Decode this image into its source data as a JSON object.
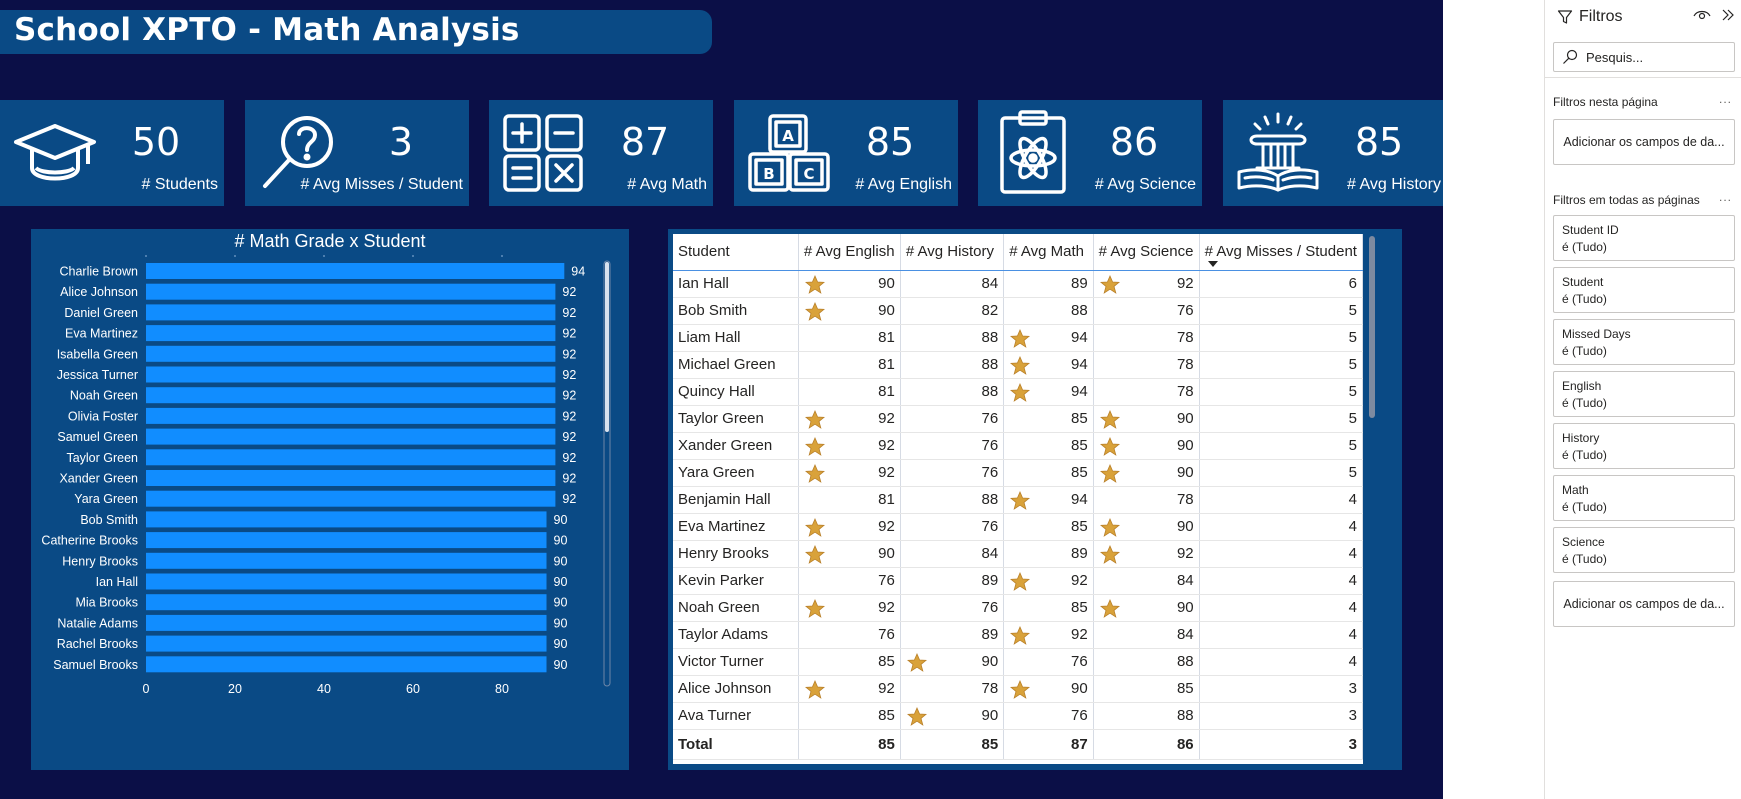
{
  "report": {
    "title": "School XPTO - Math Analysis",
    "kpis": [
      {
        "value": "50",
        "label": "# Students",
        "icon": "graduation-cap-icon"
      },
      {
        "value": "3",
        "label": "# Avg Misses / Student",
        "icon": "magnifier-question-icon"
      },
      {
        "value": "87",
        "label": "# Avg Math",
        "icon": "calculator-symbols-icon"
      },
      {
        "value": "85",
        "label": "# Avg English",
        "icon": "abc-blocks-icon"
      },
      {
        "value": "86",
        "label": "# Avg Science",
        "icon": "atom-clipboard-icon"
      },
      {
        "value": "85",
        "label": "# Avg History",
        "icon": "greek-column-book-icon"
      }
    ]
  },
  "chart_data": {
    "type": "bar",
    "orientation": "horizontal",
    "title": "# Math Grade x Student",
    "categories": [
      "Charlie Brown",
      "Alice Johnson",
      "Daniel Green",
      "Eva Martinez",
      "Isabella Green",
      "Jessica Turner",
      "Noah Green",
      "Olivia Foster",
      "Samuel Green",
      "Taylor Green",
      "Xander Green",
      "Yara Green",
      "Bob Smith",
      "Catherine Brooks",
      "Henry Brooks",
      "Ian Hall",
      "Mia Brooks",
      "Natalie Adams",
      "Rachel Brooks",
      "Samuel Brooks"
    ],
    "values": [
      94,
      92,
      92,
      92,
      92,
      92,
      92,
      92,
      92,
      92,
      92,
      92,
      90,
      90,
      90,
      90,
      90,
      90,
      90,
      90
    ],
    "xticks": [
      0,
      20,
      40,
      60,
      80
    ],
    "xlim": [
      0,
      100
    ],
    "bar_color": "#118dff",
    "grid": false
  },
  "table": {
    "columns": [
      "Student",
      "# Avg English",
      "# Avg History",
      "# Avg Math",
      "# Avg Science",
      "# Avg Misses / Student"
    ],
    "rows": [
      {
        "cells": [
          "Ian Hall",
          "90",
          "84",
          "89",
          "92",
          "6"
        ],
        "stars": [
          1,
          0,
          0,
          1
        ]
      },
      {
        "cells": [
          "Bob Smith",
          "90",
          "82",
          "88",
          "76",
          "5"
        ],
        "stars": [
          1,
          0,
          0,
          0
        ]
      },
      {
        "cells": [
          "Liam Hall",
          "81",
          "88",
          "94",
          "78",
          "5"
        ],
        "stars": [
          0,
          0,
          1,
          0
        ]
      },
      {
        "cells": [
          "Michael Green",
          "81",
          "88",
          "94",
          "78",
          "5"
        ],
        "stars": [
          0,
          0,
          1,
          0
        ]
      },
      {
        "cells": [
          "Quincy Hall",
          "81",
          "88",
          "94",
          "78",
          "5"
        ],
        "stars": [
          0,
          0,
          1,
          0
        ]
      },
      {
        "cells": [
          "Taylor Green",
          "92",
          "76",
          "85",
          "90",
          "5"
        ],
        "stars": [
          1,
          0,
          0,
          1
        ]
      },
      {
        "cells": [
          "Xander Green",
          "92",
          "76",
          "85",
          "90",
          "5"
        ],
        "stars": [
          1,
          0,
          0,
          1
        ]
      },
      {
        "cells": [
          "Yara Green",
          "92",
          "76",
          "85",
          "90",
          "5"
        ],
        "stars": [
          1,
          0,
          0,
          1
        ]
      },
      {
        "cells": [
          "Benjamin Hall",
          "81",
          "88",
          "94",
          "78",
          "4"
        ],
        "stars": [
          0,
          0,
          1,
          0
        ]
      },
      {
        "cells": [
          "Eva Martinez",
          "92",
          "76",
          "85",
          "90",
          "4"
        ],
        "stars": [
          1,
          0,
          0,
          1
        ]
      },
      {
        "cells": [
          "Henry Brooks",
          "90",
          "84",
          "89",
          "92",
          "4"
        ],
        "stars": [
          1,
          0,
          0,
          1
        ]
      },
      {
        "cells": [
          "Kevin Parker",
          "76",
          "89",
          "92",
          "84",
          "4"
        ],
        "stars": [
          0,
          0,
          1,
          0
        ]
      },
      {
        "cells": [
          "Noah Green",
          "92",
          "76",
          "85",
          "90",
          "4"
        ],
        "stars": [
          1,
          0,
          0,
          1
        ]
      },
      {
        "cells": [
          "Taylor Adams",
          "76",
          "89",
          "92",
          "84",
          "4"
        ],
        "stars": [
          0,
          0,
          1,
          0
        ]
      },
      {
        "cells": [
          "Victor Turner",
          "85",
          "90",
          "76",
          "88",
          "4"
        ],
        "stars": [
          0,
          1,
          0,
          0
        ]
      },
      {
        "cells": [
          "Alice Johnson",
          "92",
          "78",
          "90",
          "85",
          "3"
        ],
        "stars": [
          1,
          0,
          1,
          0
        ]
      },
      {
        "cells": [
          "Ava Turner",
          "85",
          "90",
          "76",
          "88",
          "3"
        ],
        "stars": [
          0,
          1,
          0,
          0
        ]
      }
    ],
    "total": [
      "Total",
      "85",
      "85",
      "87",
      "86",
      "3"
    ],
    "star_color": "#d9a23a",
    "sorted_column": "# Avg Misses / Student"
  },
  "filters": {
    "title": "Filtros",
    "search_placeholder": "Pesquis...",
    "page_section": "Filtros nesta página",
    "all_section": "Filtros em todas as páginas",
    "add_fields": "Adicionar os campos de da...",
    "more": "...",
    "items": [
      {
        "name": "Student ID",
        "value": "é (Tudo)"
      },
      {
        "name": "Student",
        "value": "é (Tudo)"
      },
      {
        "name": "Missed Days",
        "value": "é (Tudo)"
      },
      {
        "name": "English",
        "value": "é (Tudo)"
      },
      {
        "name": "History",
        "value": "é (Tudo)"
      },
      {
        "name": "Math",
        "value": "é (Tudo)"
      },
      {
        "name": "Science",
        "value": "é (Tudo)"
      }
    ]
  },
  "colors": {
    "background": "#0b0f47",
    "panel": "#0a4a85",
    "bar": "#118dff"
  }
}
